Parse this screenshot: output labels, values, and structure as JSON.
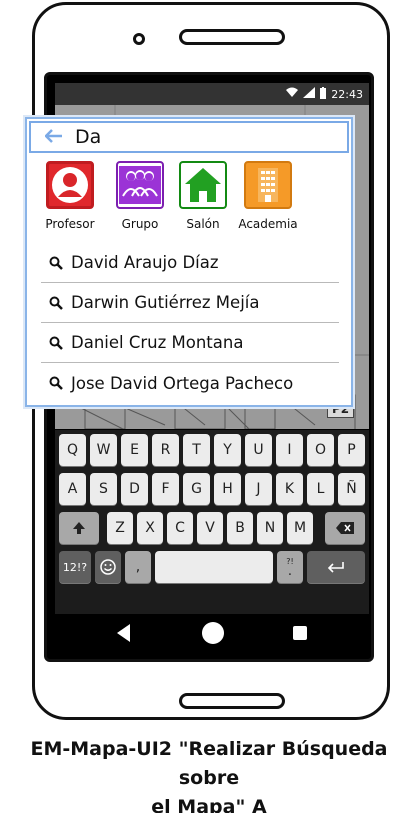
{
  "status_bar": {
    "time": "22:43",
    "icons": [
      "wifi-icon",
      "signal-icon",
      "battery-icon"
    ]
  },
  "search": {
    "query": "Da",
    "back_icon": "arrow-left-icon"
  },
  "categories": [
    {
      "label": "Profesor",
      "icon": "user-icon",
      "color": "#d9262a"
    },
    {
      "label": "Grupo",
      "icon": "group-icon",
      "color": "#9b33d6"
    },
    {
      "label": "Salón",
      "icon": "home-icon",
      "color": "#20a020"
    },
    {
      "label": "Academia",
      "icon": "building-icon",
      "color": "#f2931e"
    }
  ],
  "results": [
    {
      "name": "David Araujo Díaz"
    },
    {
      "name": "Darwin Gutiérrez Mejía"
    },
    {
      "name": "Daniel Cruz Montana"
    },
    {
      "name": "Jose David Ortega Pacheco"
    }
  ],
  "map": {
    "label": "P2"
  },
  "keyboard": {
    "row1": [
      "Q",
      "W",
      "E",
      "R",
      "T",
      "Y",
      "U",
      "I",
      "O",
      "P"
    ],
    "row2": [
      "A",
      "S",
      "D",
      "F",
      "G",
      "H",
      "J",
      "K",
      "L",
      "Ñ"
    ],
    "row3": [
      "Z",
      "X",
      "C",
      "V",
      "B",
      "N",
      "M"
    ],
    "symbols_key": "12!?",
    "comma_key": ",",
    "period_key": ".",
    "period_alt": "?!"
  },
  "caption": {
    "line1": "EM-Mapa-UI2 \"Realizar Búsqueda sobre",
    "line2": "el Mapa\" A"
  }
}
